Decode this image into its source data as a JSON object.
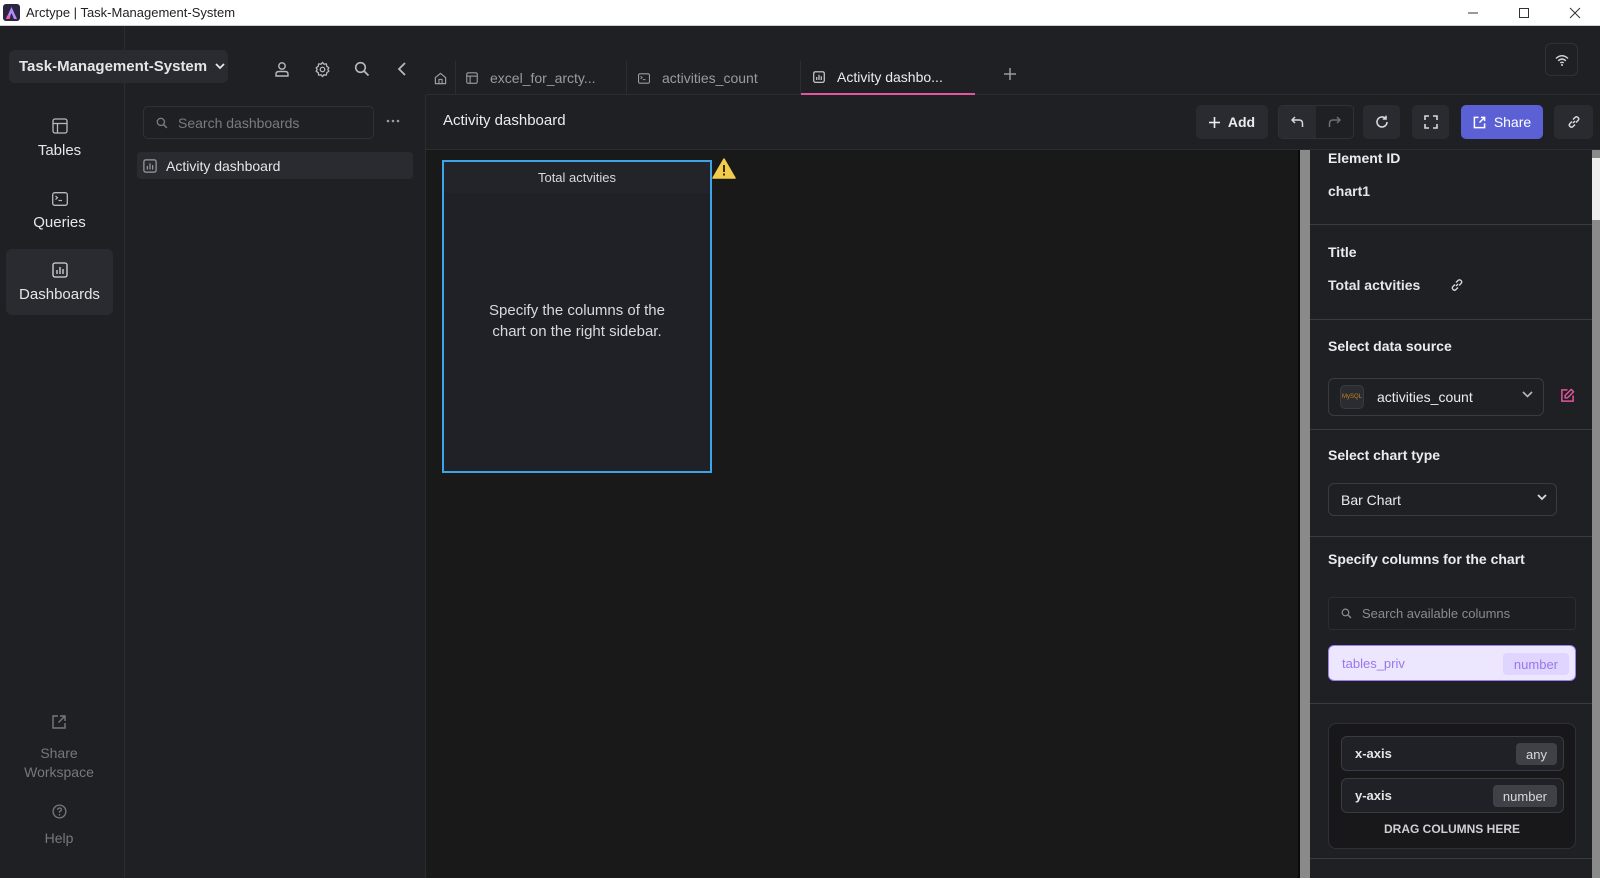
{
  "window": {
    "title": "Arctype | Task-Management-System",
    "controls": [
      "minimize-icon",
      "maximize-icon",
      "close-icon"
    ]
  },
  "workspace": {
    "name": "Task-Management-System",
    "top_icons": [
      "user-icon",
      "gear-icon",
      "search-icon",
      "chevron-left-icon"
    ]
  },
  "rail": {
    "items": [
      {
        "label": "Tables",
        "icon": "table-icon",
        "active": false
      },
      {
        "label": "Queries",
        "icon": "terminal-icon",
        "active": false
      },
      {
        "label": "Dashboards",
        "icon": "bar-chart-icon",
        "active": true
      }
    ],
    "bottom": [
      {
        "label": "Share Workspace",
        "icon": "external-link-icon"
      },
      {
        "label": "Help",
        "icon": "help-circle-icon"
      }
    ]
  },
  "dashboards_panel": {
    "search_placeholder": "Search dashboards",
    "more_label": "···",
    "items": [
      {
        "label": "Activity dashboard",
        "selected": true
      }
    ]
  },
  "tabs": [
    {
      "label": "excel_for_arcty...",
      "icon": "table-icon",
      "active": false
    },
    {
      "label": "activities_count",
      "icon": "terminal-icon",
      "active": false
    },
    {
      "label": "Activity dashbo...",
      "icon": "bar-chart-icon",
      "active": true
    }
  ],
  "toolbar": {
    "title": "Activity dashboard",
    "add_label": "Add",
    "share_label": "Share"
  },
  "canvas": {
    "chart_card": {
      "title": "Total actvities",
      "message_line1": "Specify the columns of the",
      "message_line2": "chart on the right sidebar.",
      "has_warning": true
    }
  },
  "config": {
    "element_id_label": "Element ID",
    "element_id": "chart1",
    "title_label": "Title",
    "title_value": "Total actvities",
    "data_source_label": "Select data source",
    "data_source_value": "activities_count",
    "data_source_badge": "MySQL",
    "chart_type_label": "Select chart type",
    "chart_type_value": "Bar Chart",
    "columns_label": "Specify columns for the chart",
    "columns_search_placeholder": "Search available columns",
    "available_columns": [
      {
        "name": "tables_priv",
        "type": "number"
      }
    ],
    "axes": [
      {
        "name": "x-axis",
        "type": "any"
      },
      {
        "name": "y-axis",
        "type": "number"
      }
    ],
    "drag_hint": "DRAG COLUMNS HERE"
  },
  "colors": {
    "accent_pink": "#e3559c",
    "share_blue": "#5b61d4",
    "selection_blue": "#3da4e8",
    "column_purple": "#9877e8"
  }
}
